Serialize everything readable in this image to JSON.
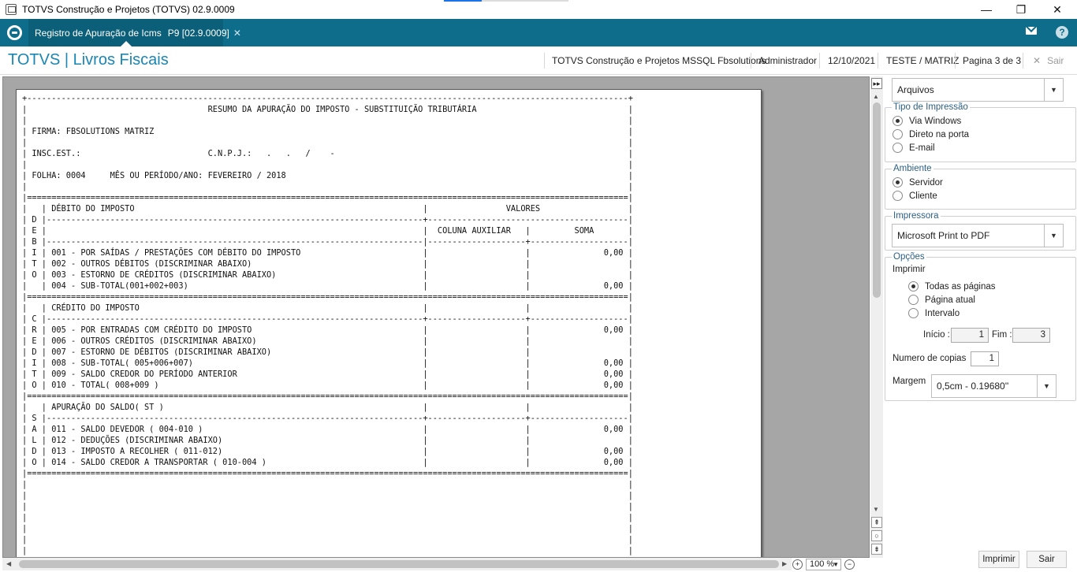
{
  "window": {
    "title": "TOTVS Construção e Projetos (TOTVS) 02.9.0009",
    "minimize_glyph": "—",
    "restore_glyph": "❐",
    "close_glyph": "✕"
  },
  "tabbar": {
    "tab_label": "Registro de Apuração de Icms",
    "tab_version": "P9 [02.9.0009]",
    "tab_close": "✕",
    "help_glyph": "?"
  },
  "header": {
    "brand": "TOTVS | Livros Fiscais",
    "company": "TOTVS Construção e Projetos MSSQL Fbsolutions",
    "user": "Administrador",
    "date": "12/10/2021",
    "branch": "TESTE / MATRIZ",
    "page": "Pagina 3 de 3",
    "exit_label": "Sair",
    "exit_glyph": "✕"
  },
  "report": {
    "lines": [
      "+---------------------------------------------------------------------------------------------------------------------------+",
      "|                                     RESUMO DA APURAÇÃO DO IMPOSTO - SUBSTITUIÇÃO TRIBUTÁRIA                               |",
      "|                                                                                                                           |",
      "| FIRMA: FBSOLUTIONS MATRIZ                                                                                                 |",
      "|                                                                                                                           |",
      "| INSC.EST.:                          C.N.P.J.:   .   .   /    -                                                            |",
      "|                                                                                                                           |",
      "| FOLHA: 0004     MÊS OU PERÍODO/ANO: FEVEREIRO / 2018                                                                      |",
      "|                                                                                                                           |",
      "|===========================================================================================================================|",
      "|   | DÉBITO DO IMPOSTO                                                           |                VALORES                  |",
      "| D |-----------------------------------------------------------------------------+-----------------------------------------|",
      "| E |                                                                             |  COLUNA AUXILIAR   |         SOMA       |",
      "| B |-----------------------------------------------------------------------------|--------------------+--------------------|",
      "| I | 001 - POR SAÍDAS / PRESTAÇÕES COM DÉBITO DO IMPOSTO                         |                    |               0,00 |",
      "| T | 002 - OUTROS DÉBITOS (DISCRIMINAR ABAIXO)                                   |                    |                    |",
      "| O | 003 - ESTORNO DE CRÉDITOS (DISCRIMINAR ABAIXO)                              |                    |                    |",
      "|   | 004 - SUB-TOTAL(001+002+003)                                                |                    |               0,00 |",
      "|===========================================================================================================================|",
      "|   | CRÉDITO DO IMPOSTO                                                          |                    |                    |",
      "| C |-----------------------------------------------------------------------------+--------------------+--------------------|",
      "| R | 005 - POR ENTRADAS COM CRÉDITO DO IMPOSTO                                   |                    |               0,00 |",
      "| E | 006 - OUTROS CRÉDITOS (DISCRIMINAR ABAIXO)                                  |                    |                    |",
      "| D | 007 - ESTORNO DE DÉBITOS (DISCRIMINAR ABAIXO)                               |                    |                    |",
      "| I | 008 - SUB-TOTAL( 005+006+007)                                               |                    |               0,00 |",
      "| T | 009 - SALDO CREDOR DO PERÍODO ANTERIOR                                      |                    |               0,00 |",
      "| O | 010 - TOTAL( 008+009 )                                                      |                    |               0,00 |",
      "|===========================================================================================================================|",
      "|   | APURAÇÃO DO SALDO( ST )                                                     |                    |                    |",
      "| S |-----------------------------------------------------------------------------+--------------------+--------------------|",
      "| A | 011 - SALDO DEVEDOR ( 004-010 )                                             |                    |               0,00 |",
      "| L | 012 - DEDUÇÕES (DISCRIMINAR ABAIXO)                                         |                    |                    |",
      "| D | 013 - IMPOSTO A RECOLHER ( 011-012)                                         |                    |               0,00 |",
      "| O | 014 - SALDO CREDOR A TRANSPORTAR ( 010-004 )                                |                    |               0,00 |",
      "|===========================================================================================================================|",
      "|                                                                                                                           |",
      "|                                                                                                                           |",
      "|                                                                                                                           |",
      "|                                                                                                                           |",
      "|                                                                                                                           |",
      "|                                                                                                                           |",
      "|                                                                                                                           |",
      "|                                                                                                                           |"
    ]
  },
  "scroll": {
    "toggle_glyph": "▸▸",
    "up": "▲",
    "down": "▼",
    "left": "◀",
    "right": "▶",
    "page_up": "⇞",
    "center": "○",
    "page_down": "⇟"
  },
  "zoom": {
    "icon_in": "+",
    "icon_out": "−",
    "value": "100 %",
    "arrow": "▼"
  },
  "side": {
    "output_selected": "Arquivos",
    "dropdown_glyph": "▼",
    "tipo_title": "Tipo de Impressão",
    "tipo_options": [
      "Via Windows",
      "Direto na porta",
      "E-mail"
    ],
    "tipo_selected": 0,
    "ambiente_title": "Ambiente",
    "ambiente_options": [
      "Servidor",
      "Cliente"
    ],
    "ambiente_selected": 0,
    "impressora_title": "Impressora",
    "impressora_selected": "Microsoft Print to PDF",
    "opcoes_title": "Opções",
    "imprimir_label": "Imprimir",
    "imprimir_options": [
      "Todas as páginas",
      "Página atual",
      "Intervalo"
    ],
    "imprimir_selected": 0,
    "inicio_label": "Início :",
    "inicio_value": "1",
    "fim_label": "Fim :",
    "fim_value": "3",
    "copias_label": "Numero de copias",
    "copias_value": "1",
    "margem_label": "Margem",
    "margem_selected": "0,5cm - 0.19680''",
    "print_button": "Imprimir",
    "exit_button": "Sair"
  }
}
